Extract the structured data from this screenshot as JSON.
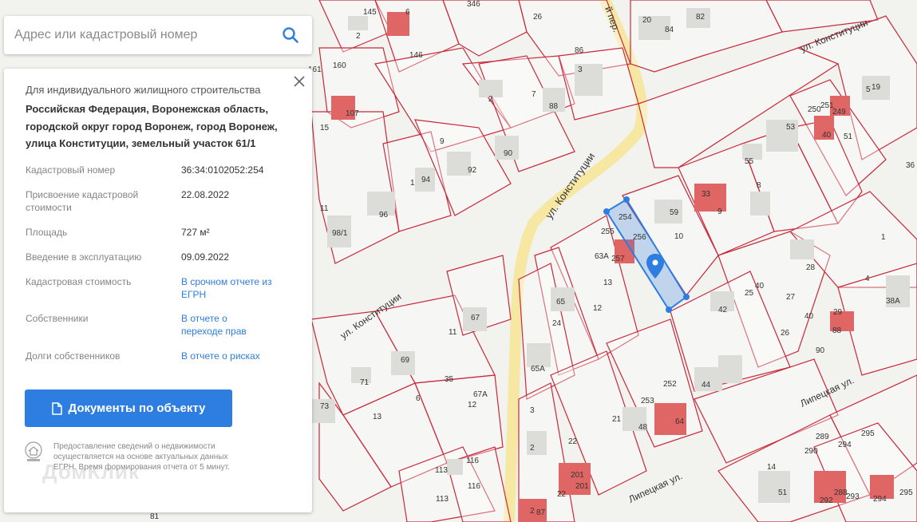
{
  "search": {
    "placeholder": "Адрес или кадастровый номер"
  },
  "panel": {
    "purpose": "Для индивидуального жилищного строительства",
    "address": "Российская Федерация, Воронежская область, городской округ город Воронеж, город Воронеж, улица Конституции, земельный участок 61/1",
    "fields": [
      {
        "label": "Кадастровый номер",
        "value": "36:34:0102052:254"
      },
      {
        "label": "Присвоение кадастровой стоимости",
        "value": "22.08.2022"
      },
      {
        "label": "Площадь",
        "value": "727 м²"
      },
      {
        "label": "Введение в эксплуатацию",
        "value": "09.09.2022"
      },
      {
        "label": "Кадастровая стоимость",
        "value": "В срочном отчете из ЕГРН"
      },
      {
        "label": "Собственники",
        "value": "В отчете о переходе прав"
      },
      {
        "label": "Долги собственников",
        "value": "В отчете о рисках"
      }
    ],
    "documents_button": "Документы по объекту",
    "footer_text": "Предоставление сведений о недвижимости осуществляется на основе актуальных данных ЕГРН. Время формирования отчета от 5 минут.",
    "watermark": "ДомКлик"
  },
  "colors": {
    "accent": "#2d7ee0",
    "parcel_line": "#c8283a",
    "building": "#dcdcd8",
    "highlight": "#2d7ee0",
    "road": "#f6e7a3"
  },
  "map": {
    "streets": [
      "ул. Конституции",
      "ул. Конституции",
      "ул. Конституции",
      "Липецкая ул.",
      "Липецкая ул.",
      "й пер."
    ],
    "parcel_numbers": [
      "145",
      "346",
      "26",
      "82",
      "84",
      "20",
      "6",
      "2",
      "146",
      "161",
      "160",
      "86",
      "3",
      "ул. Конституции",
      "107",
      "15",
      "2",
      "7",
      "88",
      "5",
      "19",
      "250",
      "249",
      "251",
      "53",
      "40",
      "51",
      "9",
      "90",
      "92",
      "55",
      "36",
      "1",
      "94",
      "96",
      "11",
      "98/1",
      "8",
      "33",
      "9",
      "254",
      "256",
      "255",
      "257",
      "59",
      "10",
      "63А",
      "13",
      "1",
      "28",
      "25",
      "40",
      "27",
      "26",
      "4",
      "38А",
      "65",
      "12",
      "24",
      "42",
      "29",
      "88",
      "40",
      "90",
      "11",
      "67",
      "69",
      "35",
      "71",
      "6",
      "73",
      "13",
      "12",
      "67А",
      "65А",
      "44",
      "252",
      "253",
      "64",
      "48",
      "21",
      "3",
      "2",
      "2",
      "22",
      "201",
      "201",
      "22",
      "87",
      "116",
      "116",
      "113",
      "113",
      "14",
      "51",
      "290",
      "289",
      "294",
      "288",
      "295",
      "292",
      "295",
      "293",
      "294",
      "81"
    ]
  }
}
